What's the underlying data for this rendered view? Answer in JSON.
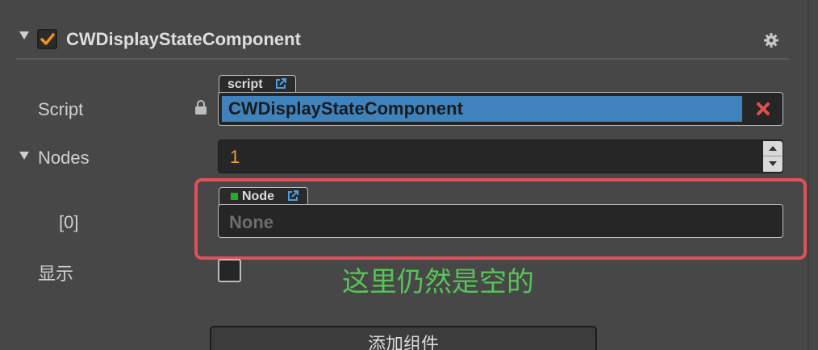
{
  "component": {
    "title": "CWDisplayStateComponent",
    "enabled": true
  },
  "properties": {
    "script": {
      "label": "Script",
      "tag": "script",
      "value": "CWDisplayStateComponent"
    },
    "nodes": {
      "label": "Nodes",
      "count": "1"
    },
    "node_item": {
      "label": "[0]",
      "tag": "Node",
      "value": "None"
    },
    "show": {
      "label": "显示",
      "checked": false
    }
  },
  "annotation": "这里仍然是空的",
  "add_component_label": "添加组件",
  "colors": {
    "panel_bg": "#474747",
    "selection_blue": "#3f82bc",
    "number_orange": "#f0a030",
    "checkbox_orange": "#f09020",
    "highlight_red": "#e0505a",
    "annotation_green": "#56c456",
    "clear_red": "#e05050",
    "node_green": "#22b022"
  },
  "icons": {
    "fold": "triangle-down-icon",
    "gear": "gear-icon",
    "lock": "lock-icon",
    "external_link": "external-link-icon",
    "clear": "close-x-icon",
    "stepper": "stepper-arrows-icon"
  }
}
